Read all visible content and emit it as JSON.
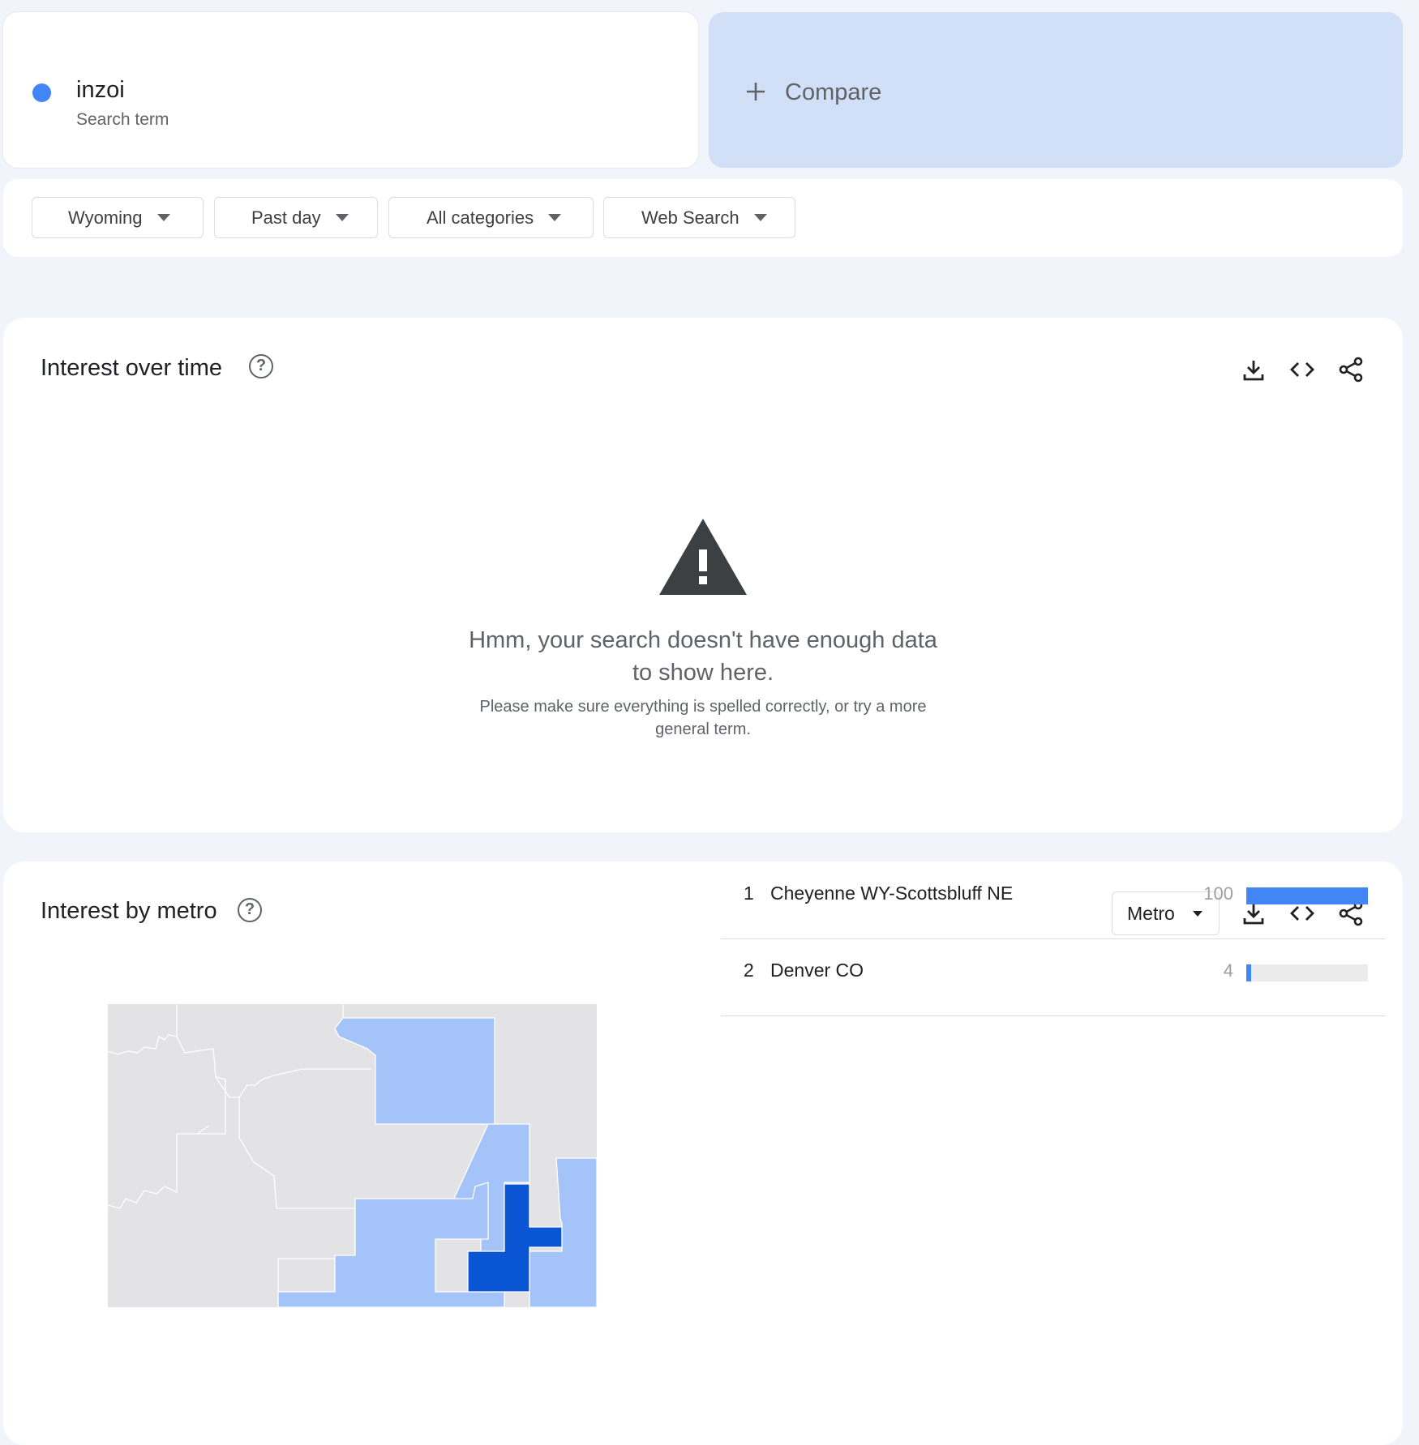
{
  "search_term": {
    "name": "inzoi",
    "subtitle": "Search term",
    "color": "#4285f4"
  },
  "compare": {
    "label": "Compare",
    "icon": "plus-icon"
  },
  "filters": [
    {
      "label": "Wyoming"
    },
    {
      "label": "Past day"
    },
    {
      "label": "All categories"
    },
    {
      "label": "Web Search"
    }
  ],
  "interest_over_time": {
    "title": "Interest over time",
    "icons": [
      "help-icon",
      "download-icon",
      "embed-code-icon",
      "share-icon"
    ],
    "message": "Hmm, your search doesn't have enough data to show here.",
    "hint": "Please make sure everything is spelled correctly, or try a more general term."
  },
  "interest_by_metro": {
    "title": "Interest by metro",
    "resolution": "Metro",
    "icons": [
      "help-icon",
      "download-icon",
      "embed-code-icon",
      "share-icon"
    ],
    "rows": [
      {
        "rank": "1",
        "name": "Cheyenne WY-Scottsbluff NE",
        "value": "100",
        "level": 1.0
      },
      {
        "rank": "2",
        "name": "Denver CO",
        "value": "4",
        "level": 0.04
      }
    ],
    "map_colors": {
      "none": "#e3e3e6",
      "low": "#a4c3f8",
      "high": "#0a55d4",
      "border": "#ffffff"
    }
  }
}
